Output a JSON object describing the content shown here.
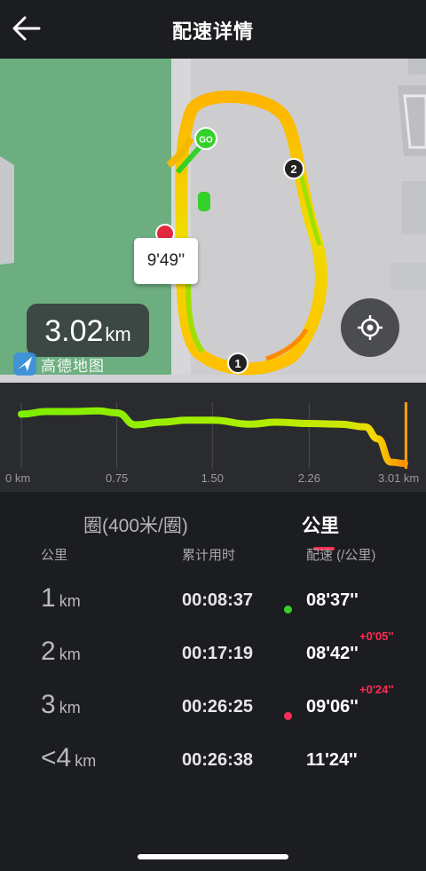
{
  "header": {
    "title": "配速详情",
    "back_icon": "arrow-left-icon"
  },
  "map": {
    "callout_pace": "9'49''",
    "distance_value": "3.02",
    "distance_unit": "km",
    "provider_logo_text": "高德地图",
    "start_marker": "GO",
    "km_markers": [
      "1",
      "2"
    ],
    "locate_icon": "crosshair-icon"
  },
  "chart_data": {
    "type": "area",
    "xlabel": "",
    "ylabel": "",
    "x_ticks": [
      "0 km",
      "0.75",
      "1.50",
      "2.26",
      "3.01 km"
    ],
    "x": [
      0,
      0.2,
      0.4,
      0.6,
      0.75,
      0.9,
      1.1,
      1.3,
      1.5,
      1.8,
      2.0,
      2.26,
      2.5,
      2.7,
      2.8,
      2.9,
      3.01
    ],
    "y_relative_pace": [
      0.82,
      0.86,
      0.86,
      0.87,
      0.84,
      0.66,
      0.7,
      0.73,
      0.73,
      0.67,
      0.7,
      0.68,
      0.67,
      0.63,
      0.45,
      0.1,
      0.08
    ],
    "grid": true,
    "colors": {
      "fast": "#7dee00",
      "mid": "#f5e600",
      "slow": "#ff8a00",
      "end_marker": "#ff9d00"
    }
  },
  "tabs": {
    "laps_label": "圈(400米/圈)",
    "km_label": "公里"
  },
  "table": {
    "headers": [
      "公里",
      "累计用时",
      "配速 (/公里)"
    ],
    "rows": [
      {
        "km": "1",
        "unit": "km",
        "cumulative": "00:08:37",
        "pace": "08'37''",
        "delta": "",
        "dot": "#35d12b"
      },
      {
        "km": "2",
        "unit": "km",
        "cumulative": "00:17:19",
        "pace": "08'42''",
        "delta": "+0'05''",
        "dot": ""
      },
      {
        "km": "3",
        "unit": "km",
        "cumulative": "00:26:25",
        "pace": "09'06''",
        "delta": "+0'24''",
        "dot": "#ff2d55"
      },
      {
        "km": "<4",
        "unit": "km",
        "cumulative": "00:26:38",
        "pace": "11'24''",
        "delta": "",
        "dot": ""
      }
    ]
  },
  "colors": {
    "accent": "#ff2d55",
    "background": "#1c1d21"
  }
}
